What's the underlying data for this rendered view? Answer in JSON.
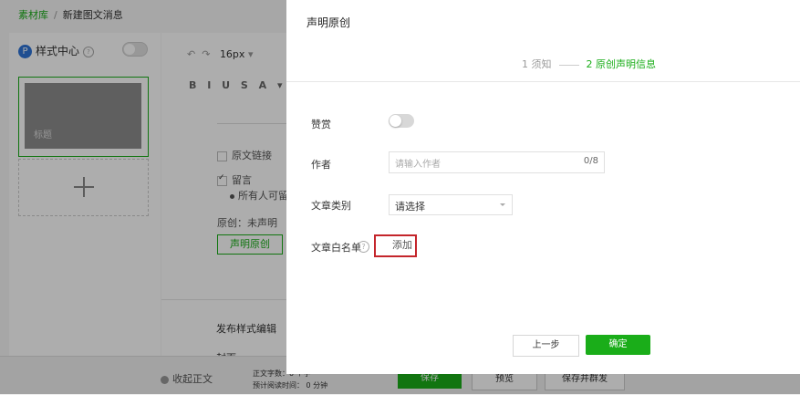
{
  "background": {
    "breadcrumb": {
      "root": "素材库",
      "separator": "/",
      "current": "新建图文消息"
    },
    "style_center": {
      "badge": "P",
      "label": "样式中心",
      "help": "?"
    },
    "article_card": {
      "title_placeholder": "标题"
    },
    "toolbar": {
      "font_size": "16px",
      "font_size_more": "▾",
      "format_buttons": "B I U S A ▾"
    },
    "options": {
      "original_link": "原文链接",
      "comment": "留言",
      "comment_scope": "所有人可留言",
      "original_status": "原创：未声明",
      "declare_button": "声明原创",
      "publish_style": "发布样式编辑",
      "cover": "封面"
    },
    "bottom": {
      "collapse": "收起正文",
      "word_count": "正文字数：0 个字",
      "read_time": "预计阅读时间：  0 分钟",
      "save": "保存",
      "preview": "预览",
      "save_and_send": "保存并群发"
    }
  },
  "dialog": {
    "title": "声明原创",
    "steps": [
      {
        "label": "1 须知",
        "active": false
      },
      {
        "label": "2 原创声明信息",
        "active": true
      }
    ],
    "fields": {
      "tip_label": "赞赏",
      "tip_enabled": false,
      "author_label": "作者",
      "author_placeholder": "请输入作者",
      "author_count": "0/8",
      "category_label": "文章类别",
      "category_value": "请选择",
      "whitelist_label": "文章白名单",
      "whitelist_help": "?",
      "whitelist_add": "添加"
    },
    "buttons": {
      "prev": "上一步",
      "confirm": "确定"
    }
  },
  "colors": {
    "accent": "#1aad19",
    "highlight": "#c4252b"
  }
}
